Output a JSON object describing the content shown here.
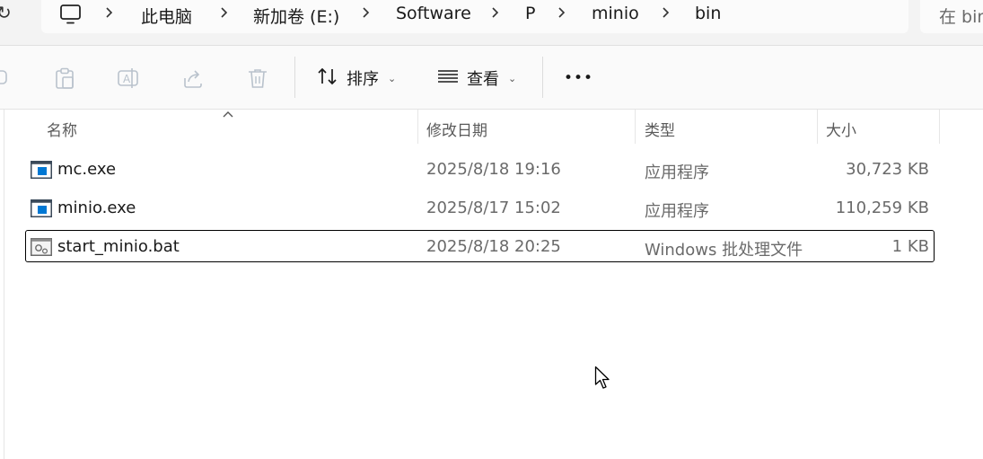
{
  "address_bar": {
    "refresh_icon": "refresh-icon",
    "computer_icon": "computer-icon",
    "crumbs": [
      "此电脑",
      "新加卷 (E:)",
      "Software",
      "P",
      "minio",
      "bin"
    ]
  },
  "search": {
    "placeholder": "在 bin"
  },
  "toolbar": {
    "icons": [
      "new-icon",
      "paste-icon",
      "rename-icon",
      "share-icon",
      "delete-icon"
    ],
    "sort_label": "排序",
    "view_label": "查看",
    "more_label": "•••"
  },
  "columns": {
    "name": "名称",
    "modified": "修改日期",
    "type": "类型",
    "size": "大小"
  },
  "files": [
    {
      "name": "mc.exe",
      "modified": "2025/8/18 19:16",
      "type": "应用程序",
      "size": "30,723 KB",
      "icon": "exe-icon"
    },
    {
      "name": "minio.exe",
      "modified": "2025/8/17 15:02",
      "type": "应用程序",
      "size": "110,259 KB",
      "icon": "exe-icon"
    },
    {
      "name": "start_minio.bat",
      "modified": "2025/8/18 20:25",
      "type": "Windows 批处理文件",
      "size": "1 KB",
      "icon": "bat-icon"
    }
  ],
  "colors": {
    "focus_border": "#000000",
    "accent": "#0063b1"
  }
}
